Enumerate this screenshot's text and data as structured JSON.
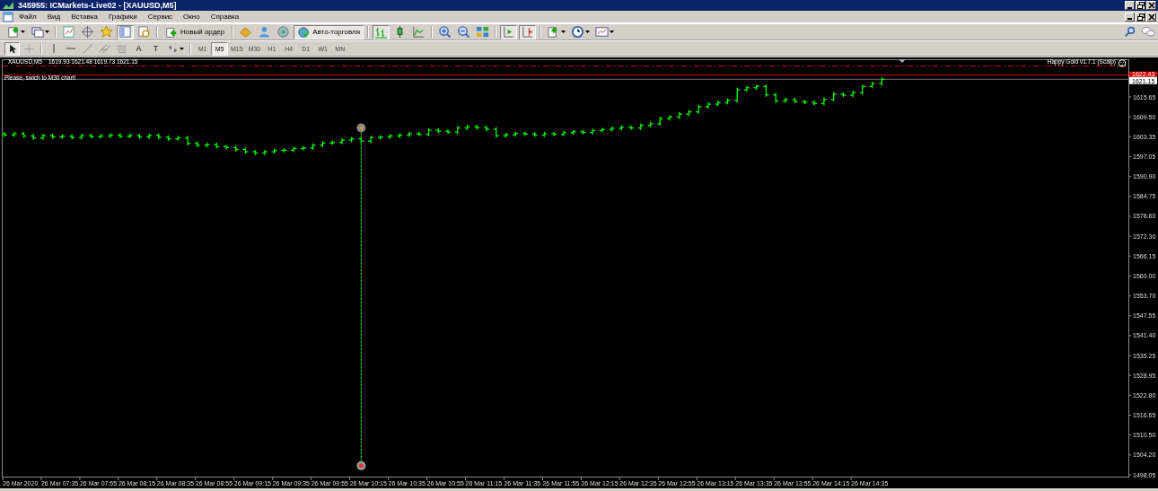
{
  "window": {
    "title": "345955: ICMarkets-Live02 - [XAUUSD,M5]"
  },
  "menu": [
    "Файл",
    "Вид",
    "Вставка",
    "Графики",
    "Сервис",
    "Окно",
    "Справка"
  ],
  "toolbar_1": [
    {
      "kind": "icon",
      "pressed": false
    },
    {
      "kind": "icon",
      "pressed": false
    },
    {
      "kind": "separator"
    },
    {
      "kind": "icon",
      "pressed": false
    },
    {
      "kind": "icon",
      "pressed": false
    },
    {
      "kind": "icon",
      "pressed": false
    },
    {
      "kind": "icon",
      "pressed": true
    },
    {
      "kind": "icon",
      "pressed": false
    },
    {
      "kind": "separator"
    },
    {
      "kind": "button",
      "label": "Новый ордер",
      "pressed": false
    },
    {
      "kind": "separator"
    },
    {
      "kind": "icon",
      "pressed": false
    },
    {
      "kind": "icon",
      "pressed": false
    },
    {
      "kind": "icon",
      "pressed": false
    },
    {
      "kind": "button",
      "label": "Авто-торговля",
      "pressed": true
    },
    {
      "kind": "separator"
    },
    {
      "kind": "icon",
      "pressed": true
    },
    {
      "kind": "icon",
      "pressed": false
    },
    {
      "kind": "icon",
      "pressed": false
    },
    {
      "kind": "separator"
    },
    {
      "kind": "icon",
      "pressed": false
    },
    {
      "kind": "icon",
      "pressed": false
    },
    {
      "kind": "icon",
      "pressed": false
    },
    {
      "kind": "separator"
    },
    {
      "kind": "icon",
      "pressed": true
    },
    {
      "kind": "icon",
      "pressed": true
    },
    {
      "kind": "separator"
    },
    {
      "kind": "icon",
      "pressed": false
    },
    {
      "kind": "icon",
      "pressed": false
    },
    {
      "kind": "icon",
      "pressed": false
    }
  ],
  "toolbar_2": [
    {
      "kind": "icon",
      "pressed": true
    },
    {
      "kind": "icon",
      "pressed": false
    },
    {
      "kind": "separator"
    },
    {
      "kind": "icon",
      "pressed": false
    },
    {
      "kind": "icon",
      "pressed": false
    },
    {
      "kind": "icon",
      "pressed": false
    },
    {
      "kind": "icon",
      "pressed": false
    },
    {
      "kind": "icon",
      "pressed": false
    },
    {
      "kind": "glyph",
      "label": "A",
      "pressed": false
    },
    {
      "kind": "glyph",
      "label": "T",
      "pressed": false
    },
    {
      "kind": "icon",
      "pressed": false
    },
    {
      "kind": "separator"
    }
  ],
  "timeframes": [
    {
      "label": "M1",
      "selected": false
    },
    {
      "label": "M5",
      "selected": true
    },
    {
      "label": "M15",
      "selected": false
    },
    {
      "label": "M30",
      "selected": false
    },
    {
      "label": "H1",
      "selected": false
    },
    {
      "label": "H4",
      "selected": false
    },
    {
      "label": "D1",
      "selected": false
    },
    {
      "label": "W1",
      "selected": false
    },
    {
      "label": "MN",
      "selected": false
    }
  ],
  "chart": {
    "symbol": "XAUUSD,M5",
    "ohlc": "1619.93 1621.48 1619.73 1621.15",
    "message": "Please, swich to M30 chart!",
    "expert": "Happy Gold v1.7.1 (Scalp)",
    "price_labels": [
      {
        "kind": "ask",
        "text": "1622.43"
      },
      {
        "kind": "bid",
        "text": "1621.15"
      }
    ],
    "price_axis": [
      "1615.65",
      "1609.50",
      "1603.35",
      "1597.05",
      "1590.90",
      "1584.75",
      "1578.60",
      "1572.30",
      "1566.15",
      "1560.00",
      "1553.70",
      "1547.55",
      "1541.40",
      "1535.25",
      "1528.95",
      "1522.80",
      "1516.65",
      "1510.50",
      "1504.20",
      "1498.05"
    ],
    "time_axis": [
      "26 Mar 2020",
      "26 Mar 07:35",
      "26 Mar 07:55",
      "26 Mar 08:15",
      "26 Mar 08:35",
      "26 Mar 08:55",
      "26 Mar 09:15",
      "26 Mar 09:35",
      "26 Mar 09:55",
      "26 Mar 10:15",
      "26 Mar 10:35",
      "26 Mar 10:55",
      "26 Mar 11:15",
      "26 Mar 11:35",
      "26 Mar 11:55",
      "26 Mar 12:15",
      "26 Mar 12:35",
      "26 Mar 12:55",
      "26 Mar 13:15",
      "26 Mar 13:35",
      "26 Mar 13:55",
      "26 Mar 14:15",
      "26 Mar 14:35"
    ]
  }
}
